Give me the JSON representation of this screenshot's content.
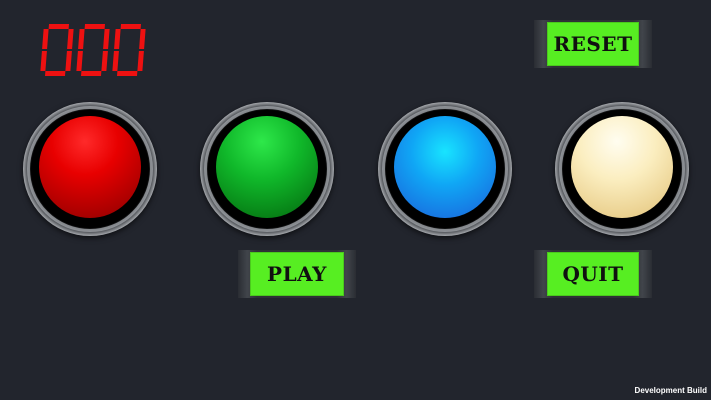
{
  "score": {
    "value": "000",
    "color": "#ee1111"
  },
  "buttons": {
    "reset_label": "RESET",
    "play_label": "PLAY",
    "quit_label": "QUIT",
    "color": "#57ee22"
  },
  "lamps": [
    {
      "name": "red",
      "color": "#e80000"
    },
    {
      "name": "green",
      "color": "#10b82a"
    },
    {
      "name": "blue",
      "color": "#10a6f5"
    },
    {
      "name": "yellow",
      "color": "#fbeec0"
    }
  ],
  "footer": {
    "build_label": "Development Build"
  }
}
